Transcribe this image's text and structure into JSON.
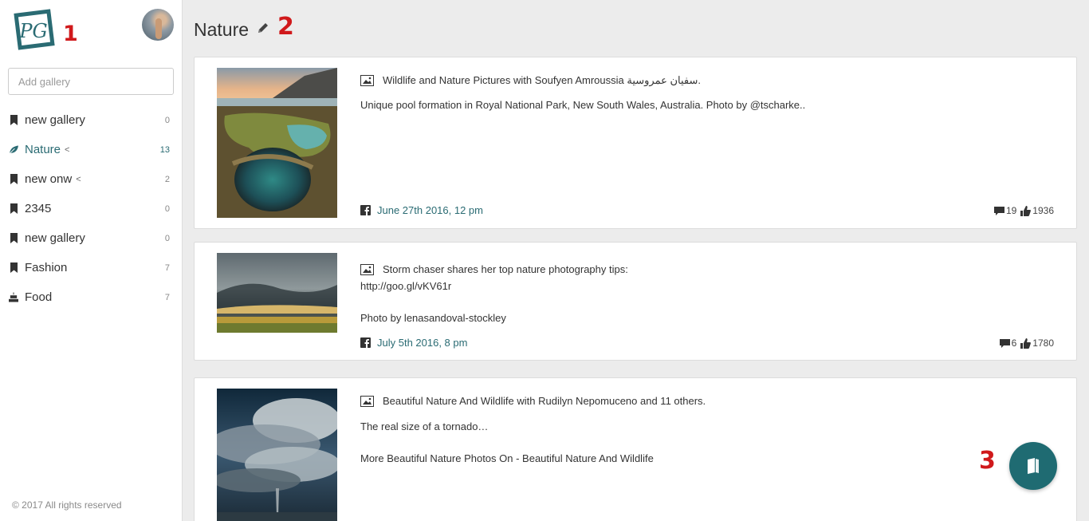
{
  "sidebar": {
    "logo_text": "PG",
    "search": {
      "placeholder": "Add gallery",
      "value": ""
    },
    "galleries": [
      {
        "label": "new gallery",
        "count": "0",
        "icon": "bookmark-icon",
        "shared": false,
        "active": false
      },
      {
        "label": "Nature",
        "count": "13",
        "icon": "leaf-icon",
        "shared": true,
        "active": true
      },
      {
        "label": "new onw",
        "count": "2",
        "icon": "bookmark-icon",
        "shared": true,
        "active": false
      },
      {
        "label": "2345",
        "count": "0",
        "icon": "bookmark-icon",
        "shared": false,
        "active": false
      },
      {
        "label": "new gallery",
        "count": "0",
        "icon": "bookmark-icon",
        "shared": false,
        "active": false
      },
      {
        "label": "Fashion",
        "count": "7",
        "icon": "bookmark-icon",
        "shared": false,
        "active": false
      },
      {
        "label": "Food",
        "count": "7",
        "icon": "cake-icon",
        "shared": false,
        "active": false
      }
    ],
    "copyright": "© 2017 All rights reserved"
  },
  "header": {
    "title": "Nature"
  },
  "annotations": {
    "a1": "1",
    "a2": "2",
    "a3": "3"
  },
  "posts": [
    {
      "source": "Wildlife and Nature Pictures with Soufyen Amroussia سفيان عمروسية.",
      "text": "Unique pool formation in Royal National Park, New South Wales, Australia. Photo by @tscharke..",
      "date": "June 27th 2016, 12 pm",
      "comments": "19",
      "likes": "1936"
    },
    {
      "source": "Storm chaser shares her top nature photography tips:",
      "text": "http://goo.gl/vKV61r\n\nPhoto by lenasandoval-stockley",
      "date": "July 5th 2016, 8 pm",
      "comments": "6",
      "likes": "1780"
    },
    {
      "source": "Beautiful Nature And Wildlife with Rudilyn Nepomuceno and 11 others.",
      "text": "The real size of a tornado…\n\nMore Beautiful Nature Photos On - Beautiful Nature And Wildlife"
    }
  ],
  "colors": {
    "accent": "#2a6b73",
    "fab": "#1f6b72",
    "annotation": "#d0191b"
  }
}
